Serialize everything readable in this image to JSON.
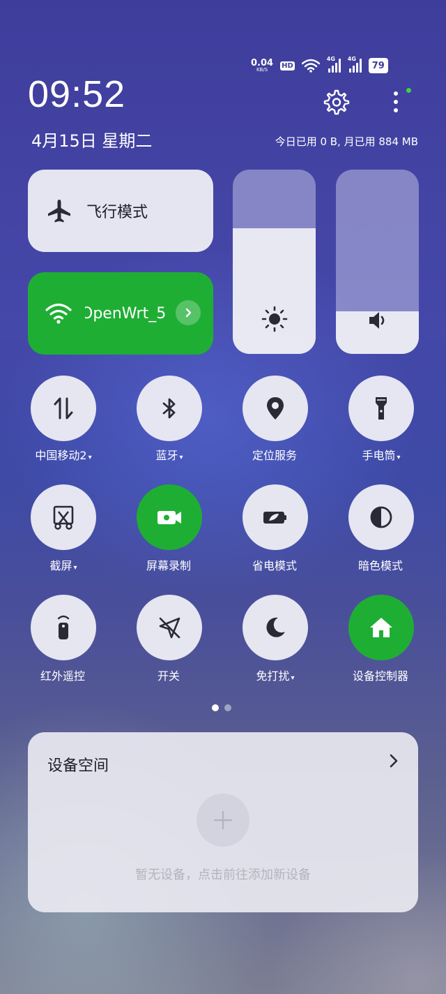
{
  "status_bar": {
    "net_speed": "0.04",
    "net_unit": "KB/S",
    "hd_badge": "HD",
    "signal_1_label": "4G",
    "signal_2_label": "4G",
    "battery": "79"
  },
  "header": {
    "time": "09:52",
    "date": "4月15日 星期二",
    "data_usage": "今日已用 0 B, 月已用 884 MB"
  },
  "tiles": {
    "airplane_label": "飞行模式",
    "wifi_label": "OpenWrt_5",
    "brightness_level": 0.68,
    "volume_level": 0.23
  },
  "toggles": [
    {
      "label": "中国移动2",
      "caret": "▾",
      "on": false
    },
    {
      "label": "蓝牙",
      "caret": "▾",
      "on": false
    },
    {
      "label": "定位服务",
      "caret": "",
      "on": false
    },
    {
      "label": "手电筒",
      "caret": "▾",
      "on": false
    },
    {
      "label": "截屏",
      "caret": "▾",
      "on": false
    },
    {
      "label": "屏幕录制",
      "caret": "",
      "on": true
    },
    {
      "label": "省电模式",
      "caret": "",
      "on": false
    },
    {
      "label": "暗色模式",
      "caret": "",
      "on": false
    },
    {
      "label": "红外遥控",
      "caret": "",
      "on": false
    },
    {
      "label": "开关",
      "caret": "",
      "on": false
    },
    {
      "label": "免打扰",
      "caret": "▾",
      "on": false
    },
    {
      "label": "设备控制器",
      "caret": "",
      "on": true
    }
  ],
  "page_indicator": {
    "current": 1,
    "total": 2
  },
  "device_space": {
    "title": "设备空间",
    "empty_text": "暂无设备，点击前往添加新设备"
  },
  "colors": {
    "accent_green": "#1fae34",
    "tile_bg": "#ececf4"
  }
}
